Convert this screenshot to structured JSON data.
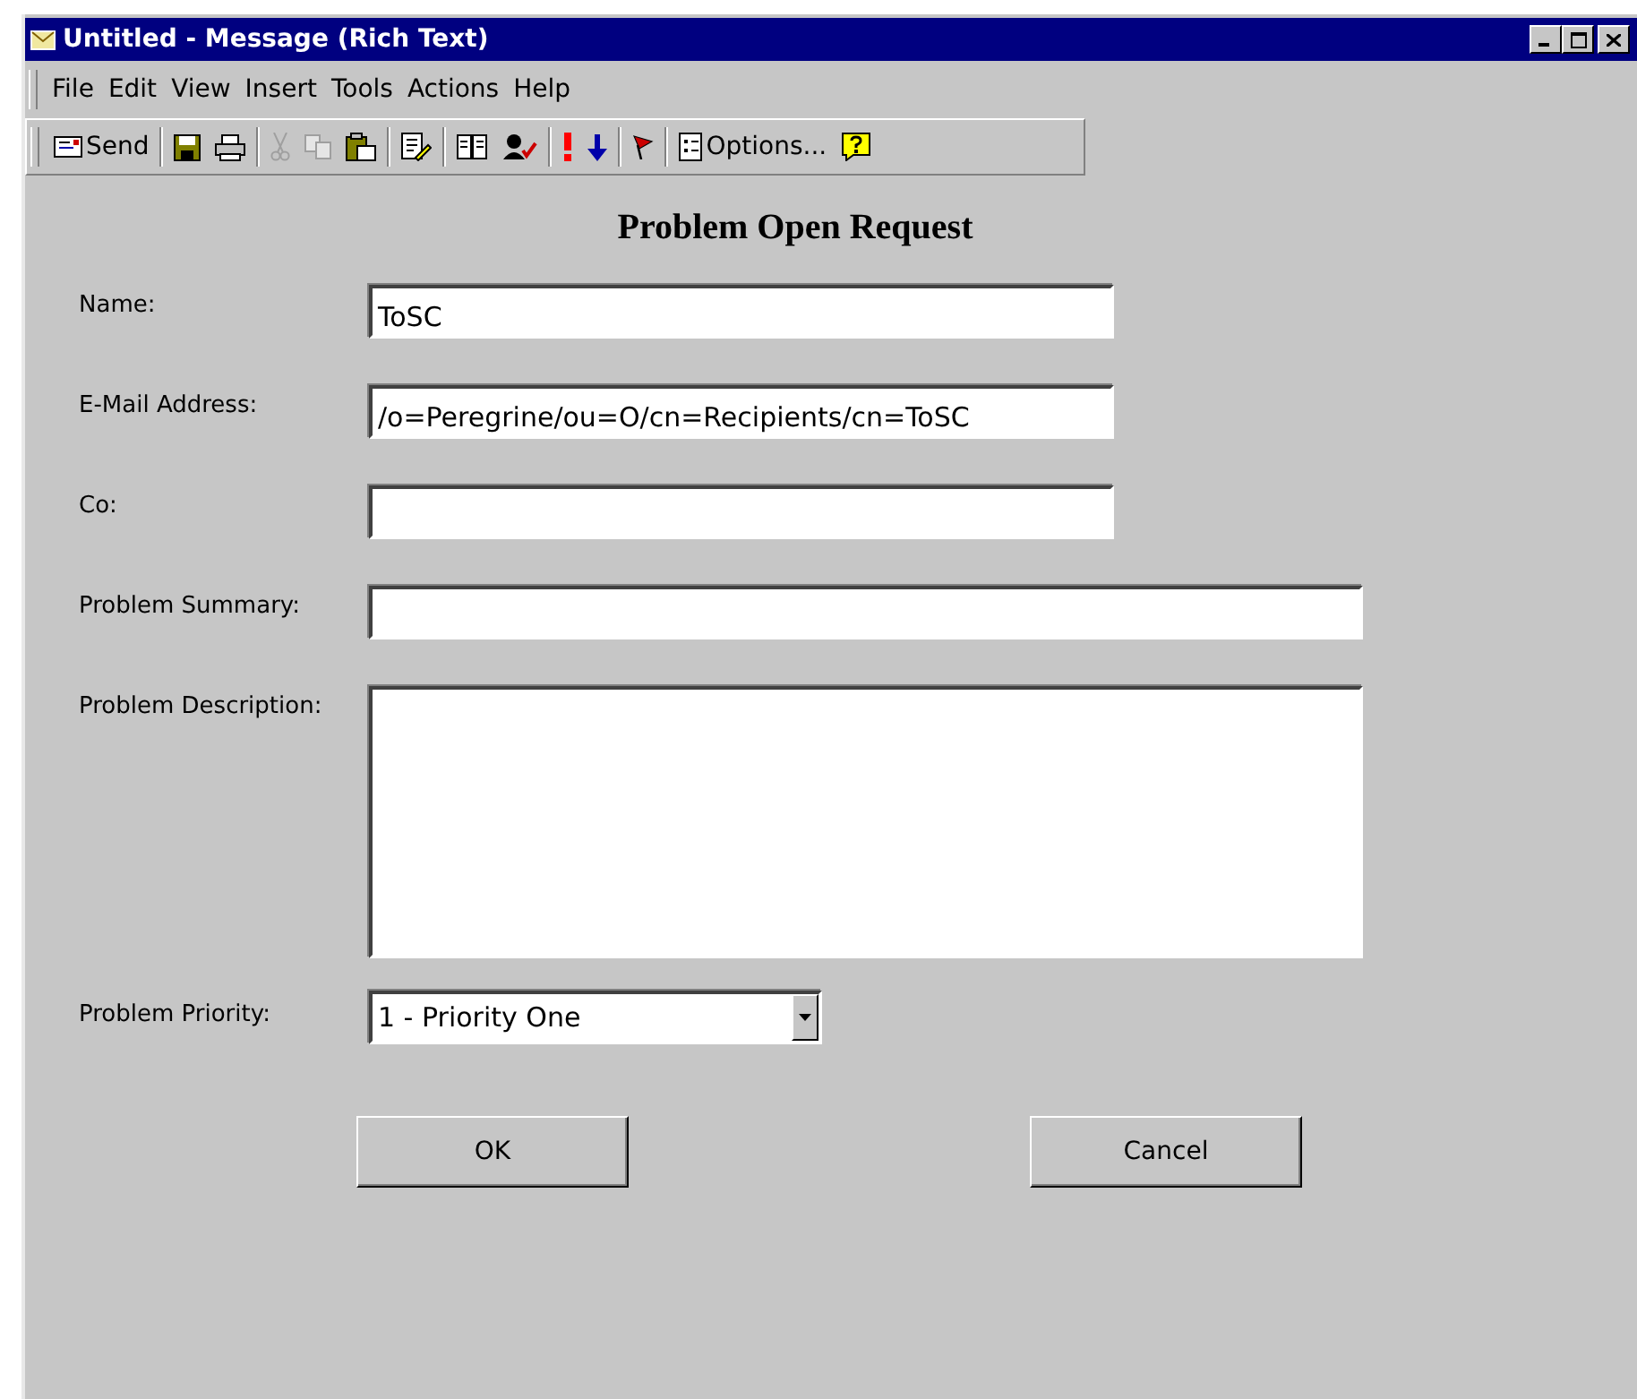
{
  "window": {
    "title": "Untitled - Message (Rich Text)"
  },
  "menu": [
    "File",
    "Edit",
    "View",
    "Insert",
    "Tools",
    "Actions",
    "Help"
  ],
  "toolbar": [
    {
      "kind": "send",
      "label": "Send",
      "disabled": false
    },
    {
      "kind": "sep"
    },
    {
      "kind": "save",
      "disabled": false
    },
    {
      "kind": "print",
      "disabled": false
    },
    {
      "kind": "sep"
    },
    {
      "kind": "cut",
      "disabled": true
    },
    {
      "kind": "copy",
      "disabled": true
    },
    {
      "kind": "paste",
      "disabled": false
    },
    {
      "kind": "sep"
    },
    {
      "kind": "edit",
      "disabled": false
    },
    {
      "kind": "sep"
    },
    {
      "kind": "book",
      "disabled": false
    },
    {
      "kind": "names",
      "disabled": false
    },
    {
      "kind": "sep"
    },
    {
      "kind": "high",
      "disabled": false
    },
    {
      "kind": "low",
      "disabled": false
    },
    {
      "kind": "sep"
    },
    {
      "kind": "flag",
      "disabled": false
    },
    {
      "kind": "sep"
    },
    {
      "kind": "options",
      "label": "Options...",
      "disabled": false
    },
    {
      "kind": "help",
      "disabled": false
    }
  ],
  "form": {
    "title": "Problem Open Request",
    "fields": [
      {
        "kind": "short",
        "label": "Name:",
        "value": "ToSC"
      },
      {
        "kind": "short",
        "label": "E-Mail Address:",
        "value": "/o=Peregrine/ou=O/cn=Recipients/cn=ToSC"
      },
      {
        "kind": "short",
        "label": "Co:"
      },
      {
        "kind": "long",
        "label": "Problem Summary:"
      },
      {
        "kind": "textarea",
        "label": "Problem Description:"
      },
      {
        "kind": "select",
        "label": "Problem Priority:",
        "value": "1 - Priority One"
      }
    ],
    "buttons": [
      "OK",
      "Cancel"
    ]
  }
}
